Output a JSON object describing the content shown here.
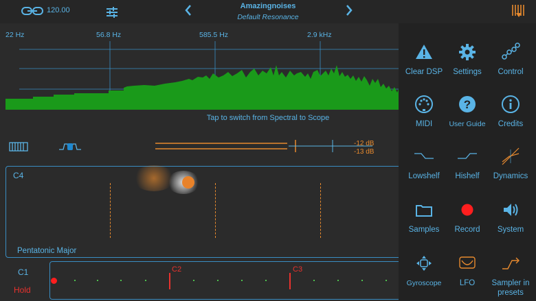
{
  "header": {
    "tempo": "120.00",
    "preset_name": "Amazingnoises",
    "preset_bank": "Default Resonance"
  },
  "spectrum": {
    "freq_labels": [
      "22 Hz",
      "56.8 Hz",
      "585.5 Hz",
      "2.9 kHz"
    ],
    "hint": "Tap to switch from Spectral to Scope"
  },
  "meter": {
    "db_top": "-12 dB",
    "db_bottom": "-13 dB"
  },
  "pad": {
    "note": "C4",
    "scale": "Pentatonic Major"
  },
  "keyboard": {
    "start_note": "C1",
    "hold_label": "Hold",
    "markers": [
      "C2",
      "C3"
    ]
  },
  "menu": {
    "items": [
      {
        "label": "Clear DSP",
        "icon": "warning-icon"
      },
      {
        "label": "Settings",
        "icon": "gear-icon"
      },
      {
        "label": "Control",
        "icon": "nodes-icon"
      },
      {
        "label": "MIDI",
        "icon": "midi-icon"
      },
      {
        "label": "User Guide",
        "icon": "help-icon"
      },
      {
        "label": "Credits",
        "icon": "info-icon"
      },
      {
        "label": "Lowshelf",
        "icon": "lowshelf-icon"
      },
      {
        "label": "Hishelf",
        "icon": "hishelf-icon"
      },
      {
        "label": "Dynamics",
        "icon": "dynamics-icon"
      },
      {
        "label": "Samples",
        "icon": "folder-icon"
      },
      {
        "label": "Record",
        "icon": "record-icon"
      },
      {
        "label": "System",
        "icon": "speaker-icon"
      },
      {
        "label": "Gyroscope",
        "icon": "gyroscope-icon"
      },
      {
        "label": "LFO",
        "icon": "lfo-icon"
      },
      {
        "label": "Sampler in presets",
        "icon": "sampler-icon"
      }
    ]
  },
  "colors": {
    "accent": "#5ab4e6",
    "spectrum_fill": "#1a9a1a",
    "orange": "#e88a2e",
    "red": "#e8322e"
  }
}
